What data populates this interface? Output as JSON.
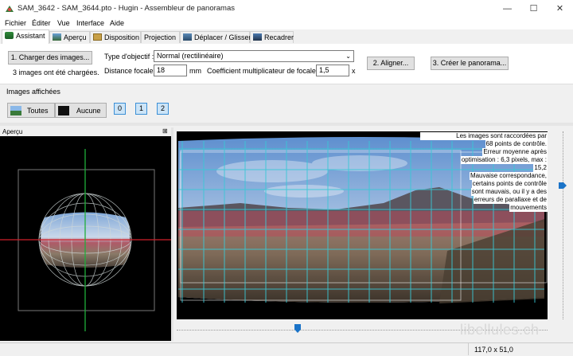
{
  "window": {
    "title": "SAM_3642 - SAM_3644.pto - Hugin - Assembleur de panoramas",
    "minimize": "—",
    "maximize": "☐",
    "close": "✕"
  },
  "menu": [
    "Fichier",
    "Éditer",
    "Vue",
    "Interface",
    "Aide"
  ],
  "tabs": [
    "Assistant",
    "Aperçu",
    "Disposition",
    "Projection",
    "Déplacer / Glisser",
    "Recadrer"
  ],
  "assistant": {
    "load_button": "1. Charger des images...",
    "load_status": "3 images ont été chargées.",
    "lens_type_label": "Type d'objectif :",
    "lens_type_value": "Normal (rectilinéaire)",
    "focal_label": "Distance focale :",
    "focal_value": "18",
    "focal_unit": "mm",
    "crop_label": "Coefficient multiplicateur de focale :",
    "crop_value": "1,5",
    "crop_unit": "x",
    "align_button": "2. Aligner...",
    "create_button": "3. Créer le panorama..."
  },
  "displayed": {
    "label": "Images affichées",
    "all_button": "Toutes",
    "none_button": "Aucune",
    "image_buttons": [
      "0",
      "1",
      "2"
    ]
  },
  "preview": {
    "label": "Aperçu",
    "pin": "⊞"
  },
  "notes": [
    "Les images sont raccordées par",
    "68 points de contrôle.",
    "Erreur moyenne après",
    "optimisation : 6,3 pixels, max :",
    "15,2",
    "Mauvaise correspondance,",
    "certains points de contrôle",
    "sont mauvais, ou il y a des",
    "erreurs de parallaxe et de",
    "mouvements"
  ],
  "watermark": "libellules.ch",
  "status_fov": "117,0 x 51,0",
  "colors": {
    "accent": "#1a73c8",
    "grid": "#39c8d6",
    "active_num_bg": "#cce4f7"
  }
}
